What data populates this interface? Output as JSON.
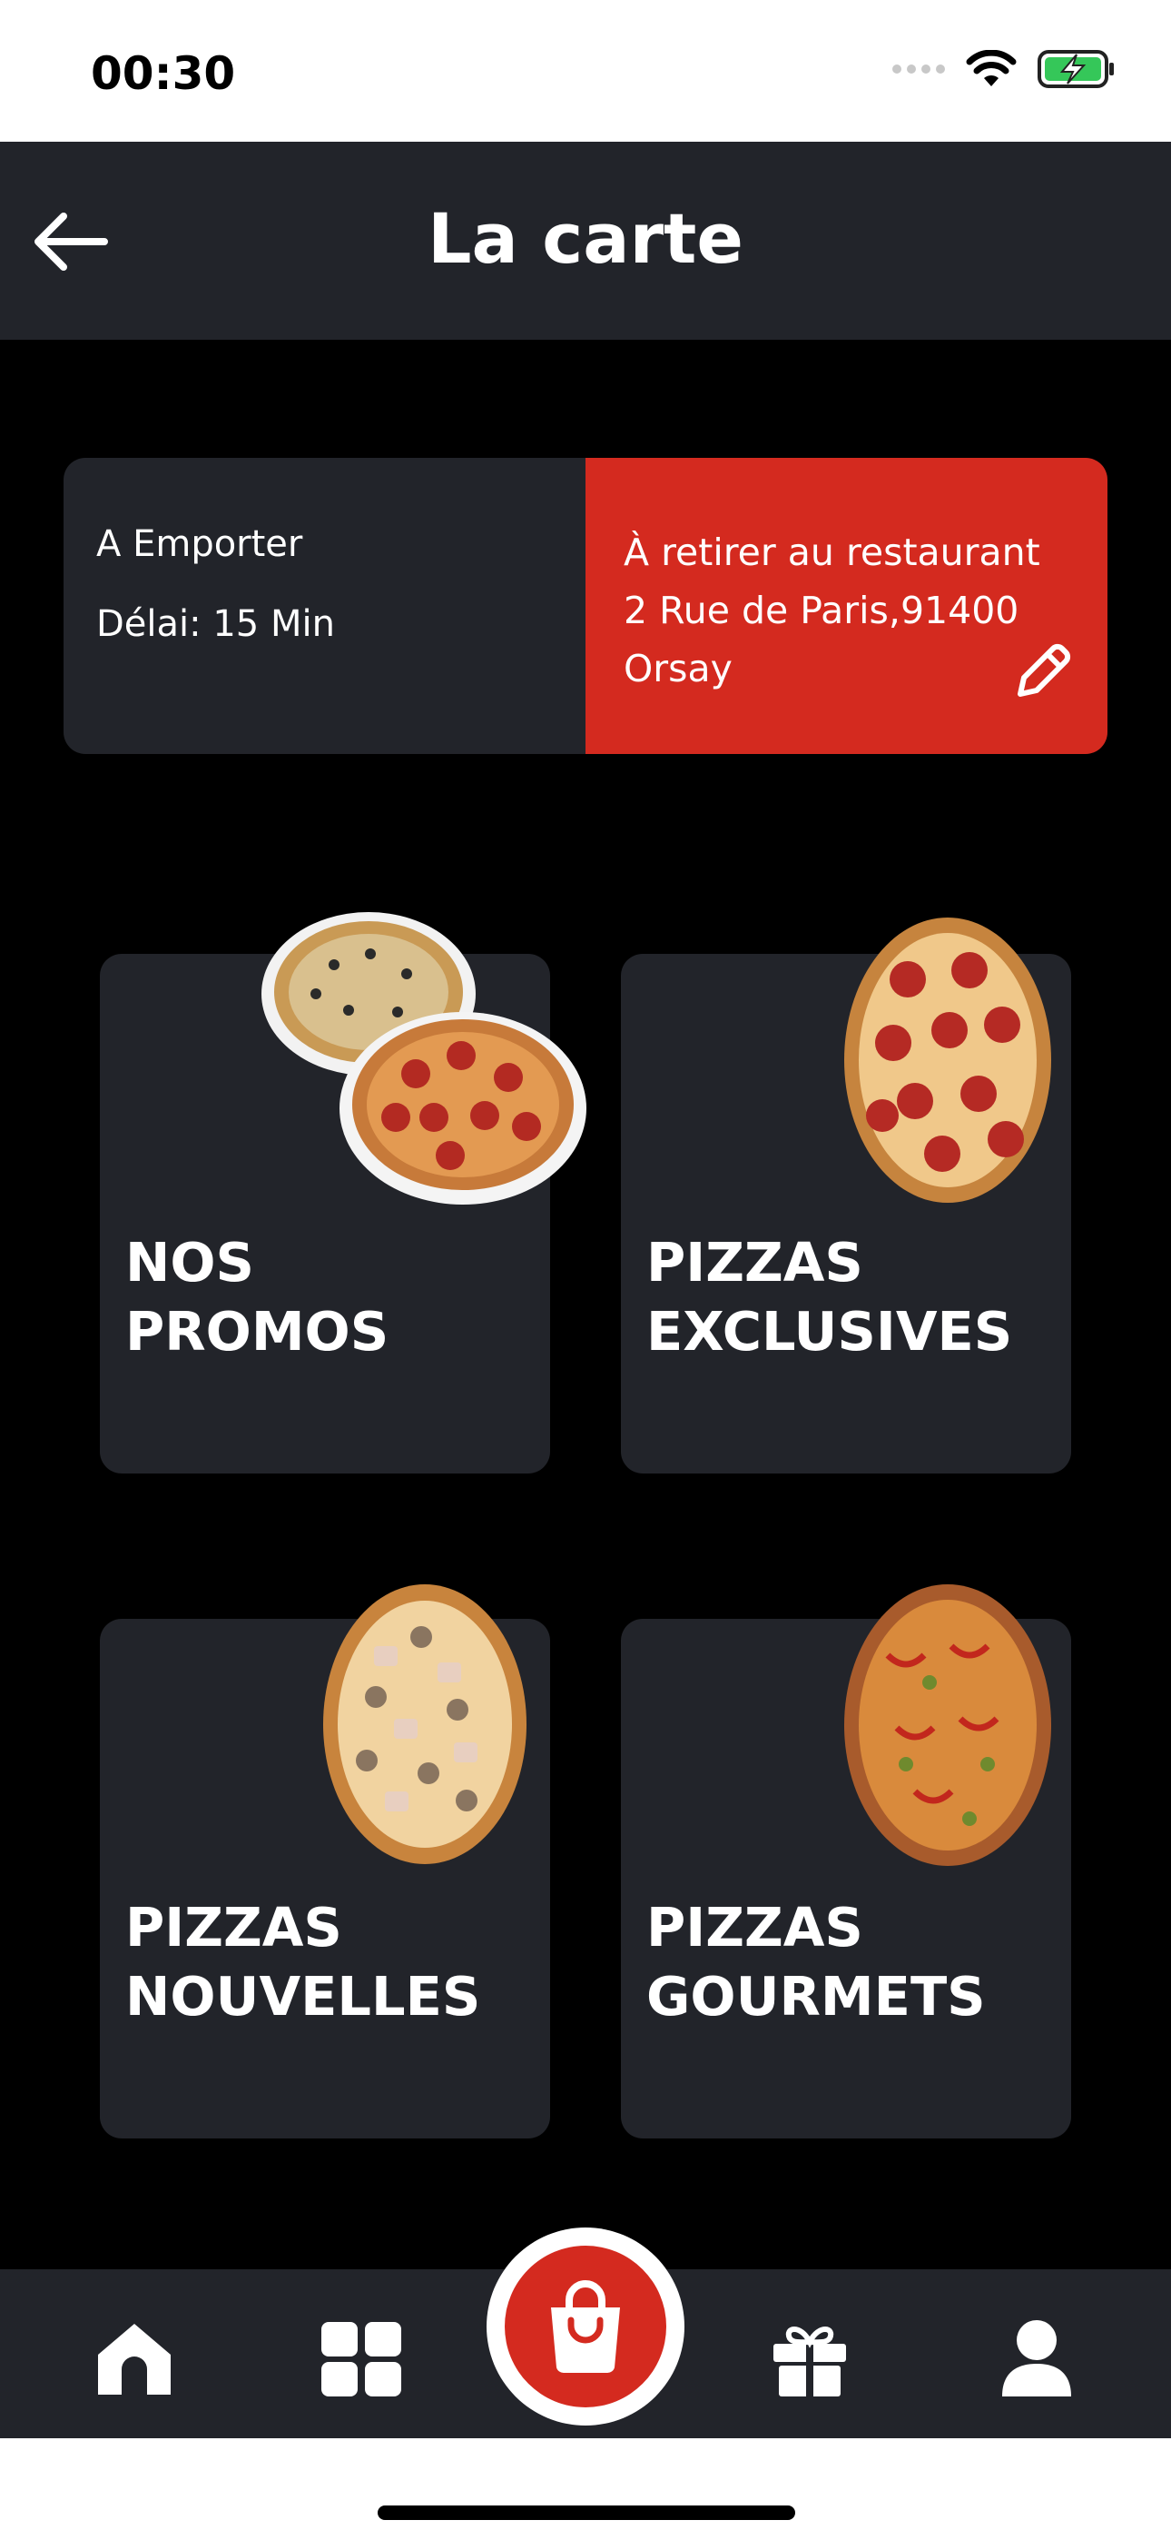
{
  "status": {
    "time": "00:30"
  },
  "header": {
    "title": "La carte",
    "back_icon": "arrow-left-icon"
  },
  "order": {
    "type": "A Emporter",
    "delay": "Délai: 15 Min",
    "pickup_lines": [
      "À retirer au restaurant",
      "2 Rue de Paris,91400",
      "Orsay"
    ],
    "edit_icon": "pencil-icon"
  },
  "categories": [
    {
      "label": "NOS PROMOS"
    },
    {
      "label": "PIZZAS EXCLUSIVES"
    },
    {
      "label": "PIZZAS NOUVELLES"
    },
    {
      "label": "PIZZAS GOURMETS"
    }
  ],
  "nav": {
    "items": [
      "home-icon",
      "grid-icon",
      "shopping-bag-icon",
      "gift-icon",
      "user-icon"
    ]
  },
  "colors": {
    "accent": "#d42a1f",
    "card": "#22242a",
    "background": "#000000"
  }
}
